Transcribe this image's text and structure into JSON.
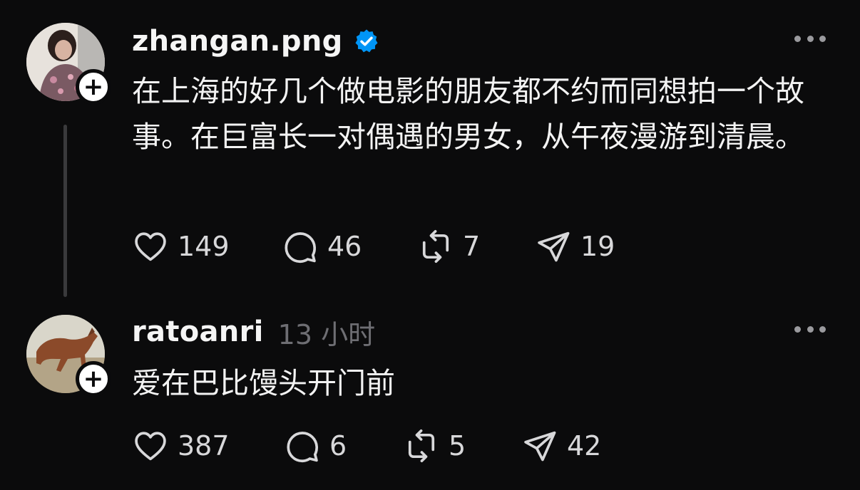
{
  "posts": [
    {
      "username": "zhangan.png",
      "verified": true,
      "text": "在上海的好几个做电影的朋友都不约而同想拍一个故事。在巨富长一对偶遇的男女，从午夜漫游到清晨。",
      "likes": "149",
      "replies": "46",
      "reposts": "7",
      "shares": "19"
    },
    {
      "username": "ratoanri",
      "timestamp": "13 小时",
      "text": "爱在巴比馒头开门前",
      "likes": "387",
      "replies": "6",
      "reposts": "5",
      "shares": "42"
    }
  ],
  "icons": {
    "like": "heart-icon",
    "reply": "comment-icon",
    "repost": "repost-icon",
    "share": "send-icon",
    "more": "more-icon",
    "follow": "plus-icon",
    "verified": "verified-badge-icon"
  },
  "colors": {
    "background": "#0b0b0c",
    "text": "#f3f3f3",
    "muted": "#6e6e73",
    "verified": "#0095f6"
  }
}
